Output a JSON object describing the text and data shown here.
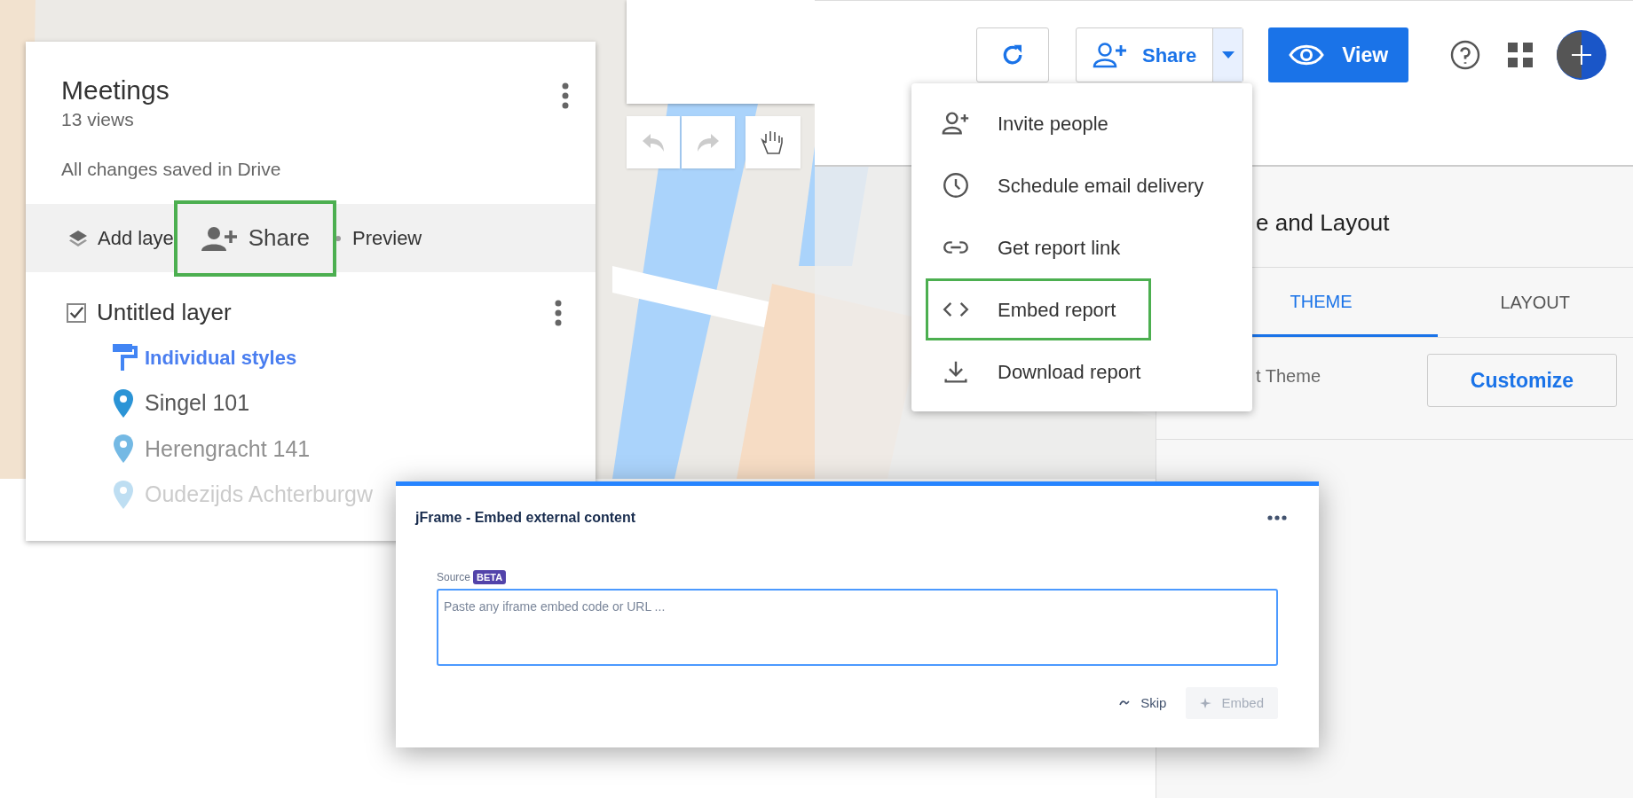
{
  "maps_panel": {
    "title": "Meetings",
    "views": "13 views",
    "save_status": "All changes saved in Drive",
    "actions": [
      {
        "kind": "layers",
        "label": "Add laye",
        "highlighted": false
      },
      {
        "kind": "share",
        "label": "Share",
        "highlighted": true
      },
      {
        "kind": "preview",
        "label": "Preview",
        "highlighted": false
      }
    ],
    "layer": {
      "name": "Untitled layer",
      "checked": true,
      "style_link": "Individual styles",
      "places": [
        {
          "name": "Singel 101"
        },
        {
          "name": "Herengracht 141"
        },
        {
          "name": "Oudezijds Achterburgw"
        }
      ]
    }
  },
  "report_header": {
    "share_button": "Share",
    "view_button": "View"
  },
  "share_menu": [
    {
      "kind": "invite",
      "label": "Invite people",
      "highlighted": false
    },
    {
      "kind": "schedule",
      "label": "Schedule email delivery",
      "highlighted": false
    },
    {
      "kind": "link",
      "label": "Get report link",
      "highlighted": false
    },
    {
      "kind": "embed",
      "label": "Embed report",
      "highlighted": true
    },
    {
      "kind": "download",
      "label": "Download report",
      "highlighted": false
    }
  ],
  "theme_panel": {
    "title": "e and Layout",
    "tabs": [
      {
        "label": "THEME",
        "selected": true
      },
      {
        "label": "LAYOUT",
        "selected": false
      }
    ],
    "current_theme": "t Theme",
    "customize_button": "Customize"
  },
  "embed_card": {
    "title": "jFrame - Embed external content",
    "field_label": "Source",
    "badge": "BETA",
    "placeholder": "Paste any iframe embed code or URL ...",
    "skip_button": "Skip",
    "embed_button": "Embed",
    "embed_disabled": true
  }
}
